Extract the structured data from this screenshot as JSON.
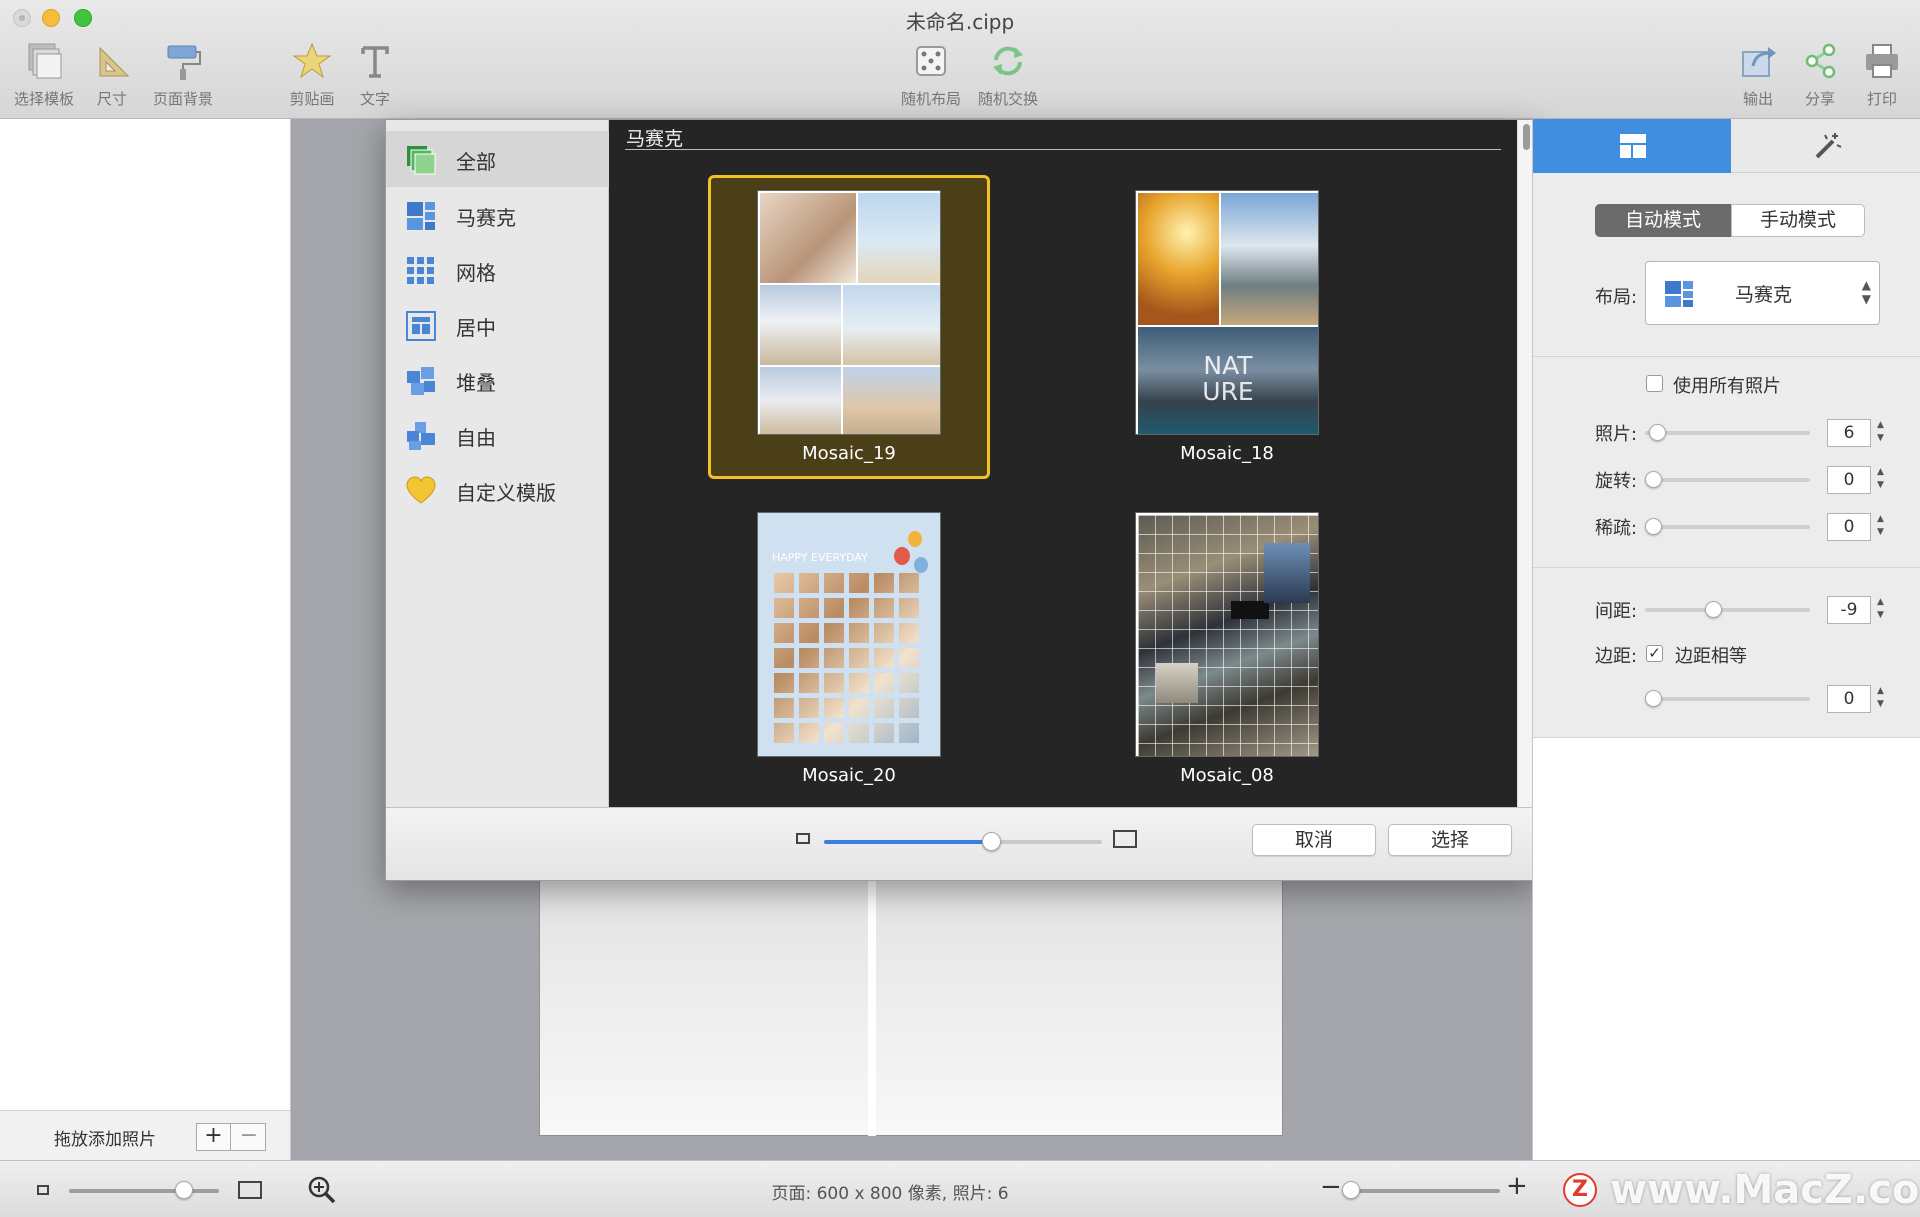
{
  "window": {
    "title": "未命名.cipp"
  },
  "toolbar": {
    "left": [
      {
        "label": "选择模板",
        "icon": "template-stack-icon"
      },
      {
        "label": "尺寸",
        "icon": "ruler-triangle-icon"
      },
      {
        "label": "页面背景",
        "icon": "paint-roller-icon"
      },
      {
        "label": "剪贴画",
        "icon": "star-icon"
      },
      {
        "label": "文字",
        "icon": "text-t-icon"
      }
    ],
    "center": [
      {
        "label": "随机布局",
        "icon": "dice-icon"
      },
      {
        "label": "随机交换",
        "icon": "shuffle-arrows-icon"
      }
    ],
    "right": [
      {
        "label": "输出",
        "icon": "export-icon"
      },
      {
        "label": "分享",
        "icon": "share-icon"
      },
      {
        "label": "打印",
        "icon": "printer-icon"
      }
    ]
  },
  "left_panel": {
    "drop_label": "拖放添加照片",
    "add": "+",
    "remove": "−"
  },
  "dialog": {
    "categories": [
      {
        "label": "全部",
        "icon": "all-templates-icon",
        "selected": true
      },
      {
        "label": "马赛克",
        "icon": "mosaic-icon"
      },
      {
        "label": "网格",
        "icon": "grid-icon"
      },
      {
        "label": "居中",
        "icon": "centered-icon"
      },
      {
        "label": "堆叠",
        "icon": "stack-icon"
      },
      {
        "label": "自由",
        "icon": "freeform-icon"
      },
      {
        "label": "自定义模版",
        "icon": "heart-icon"
      }
    ],
    "section_title": "马赛克",
    "templates": [
      {
        "name": "Mosaic_19",
        "selected": true
      },
      {
        "name": "Mosaic_18",
        "overlay": [
          "NAT",
          "URE"
        ]
      },
      {
        "name": "Mosaic_20",
        "overlay": [
          "HAPPY EVERYDAY"
        ]
      },
      {
        "name": "Mosaic_08"
      }
    ],
    "thumbnail_zoom": 0.6,
    "cancel": "取消",
    "choose": "选择"
  },
  "inspector": {
    "tabs": [
      {
        "icon": "layout-panel-icon",
        "active": true
      },
      {
        "icon": "magic-wand-icon"
      }
    ],
    "mode_auto": "自动模式",
    "mode_manual": "手动模式",
    "layout_label": "布局:",
    "layout_value": "马赛克",
    "use_all_label": "使用所有照片",
    "use_all_checked": false,
    "photos_label": "照片:",
    "photos_value": "6",
    "rotate_label": "旋转:",
    "rotate_value": "0",
    "sparse_label": "稀疏:",
    "sparse_value": "0",
    "spacing_label": "间距:",
    "spacing_value": "-9",
    "margin_label": "边距:",
    "equal_margin_label": "边距相等",
    "equal_margin_checked": true,
    "margin_value": "0"
  },
  "status": {
    "page_info": "页面: 600 x 800 像素, 照片: 6",
    "zoom_minus": "−",
    "zoom_plus": "+"
  },
  "watermark": {
    "logo": "Z",
    "text": "www.MacZ.com"
  },
  "colors": {
    "accent": "#3f8ee0",
    "selection": "#f0c224",
    "dialog_dark": "#252525"
  }
}
